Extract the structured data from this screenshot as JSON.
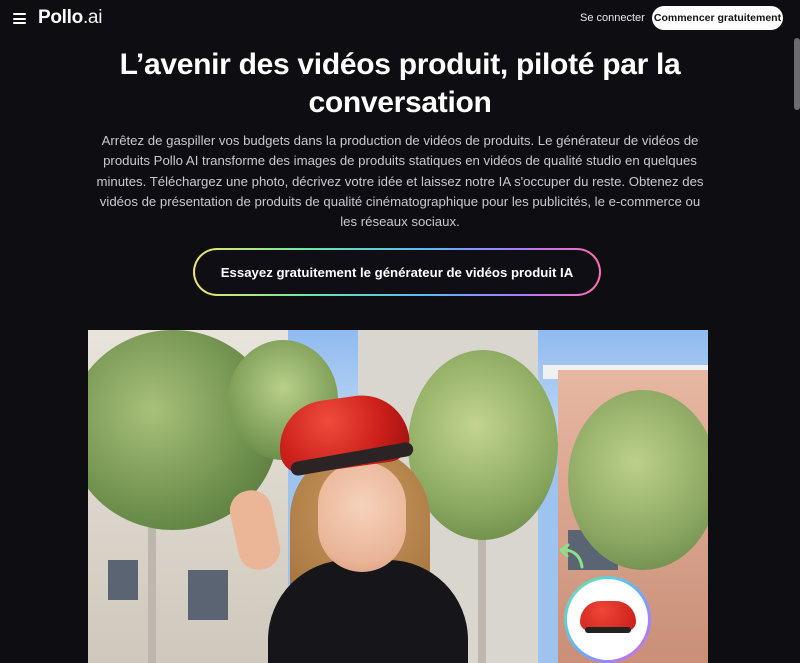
{
  "nav": {
    "logo_main": "Pollo",
    "logo_suffix": ".ai",
    "login_label": "Se connecter",
    "cta_label": "Commencer gratuitement"
  },
  "hero": {
    "title": "L’avenir des vidéos produit, piloté par la conversation",
    "description": "Arrêtez de gaspiller vos budgets dans la production de vidéos de produits. Le générateur de vidéos de produits Pollo AI transforme des images de produits statiques en vidéos de qualité studio en quelques minutes. Téléchargez une photo, décrivez votre idée et laissez notre IA s'occuper du reste. Obtenez des vidéos de présentation de produits de qualité cinématographique pour les publicités, le e-commerce ou les réseaux sociaux.",
    "button_label": "Essayez gratuitement le générateur de vidéos produit IA"
  },
  "media": {
    "subject": "woman-wearing-red-beret",
    "inset_product": "red-beret",
    "arrow_icon": "curved-arrow-icon"
  },
  "colors": {
    "background": "#0d0d12",
    "accent_gradient": [
      "#f2e46b",
      "#6ee7a5",
      "#5fb4ff",
      "#a97bff",
      "#ff6fb0"
    ],
    "cta_bg": "#ffffff"
  }
}
